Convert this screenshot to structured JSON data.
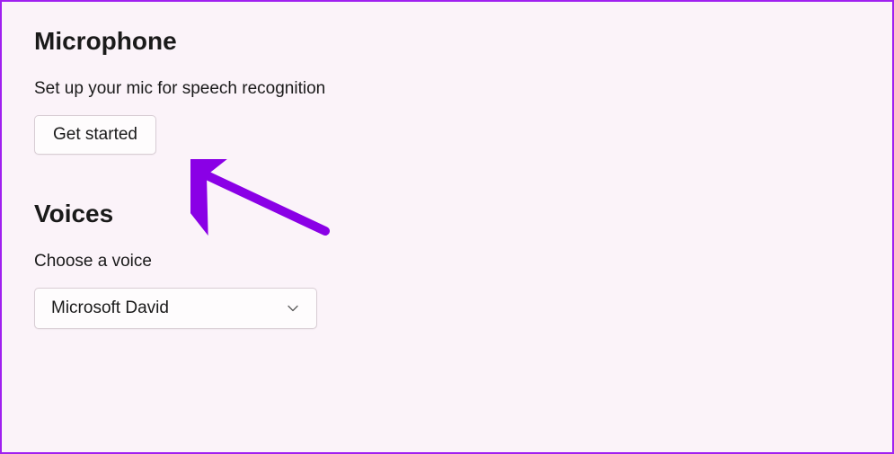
{
  "microphone": {
    "title": "Microphone",
    "description": "Set up your mic for speech recognition",
    "button_label": "Get started"
  },
  "voices": {
    "title": "Voices",
    "select_label": "Choose a voice",
    "selected": "Microsoft David"
  },
  "colors": {
    "accent": "#a020f0",
    "background": "#fbf3f9"
  }
}
